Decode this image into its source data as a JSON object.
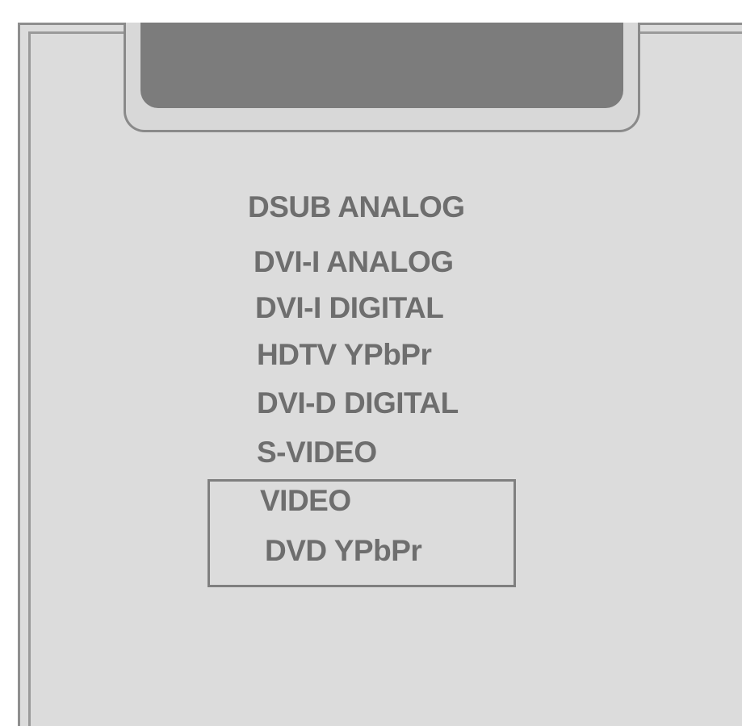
{
  "source_menu": {
    "items": [
      {
        "label": "DSUB ANALOG"
      },
      {
        "label": "DVI-I ANALOG"
      },
      {
        "label": "DVI-I DIGITAL"
      },
      {
        "label": "HDTV YPbPr"
      },
      {
        "label": "DVI-D DIGITAL"
      },
      {
        "label": "S-VIDEO"
      },
      {
        "label": "VIDEO"
      },
      {
        "label": "DVD YPbPr"
      }
    ],
    "highlighted_items": [
      "VIDEO",
      "DVD YPbPr"
    ]
  },
  "colors": {
    "panel_background": "#dcdcdc",
    "display_window": "#7c7c7c",
    "text": "#6e6e6e",
    "border": "#8a8a8a"
  }
}
